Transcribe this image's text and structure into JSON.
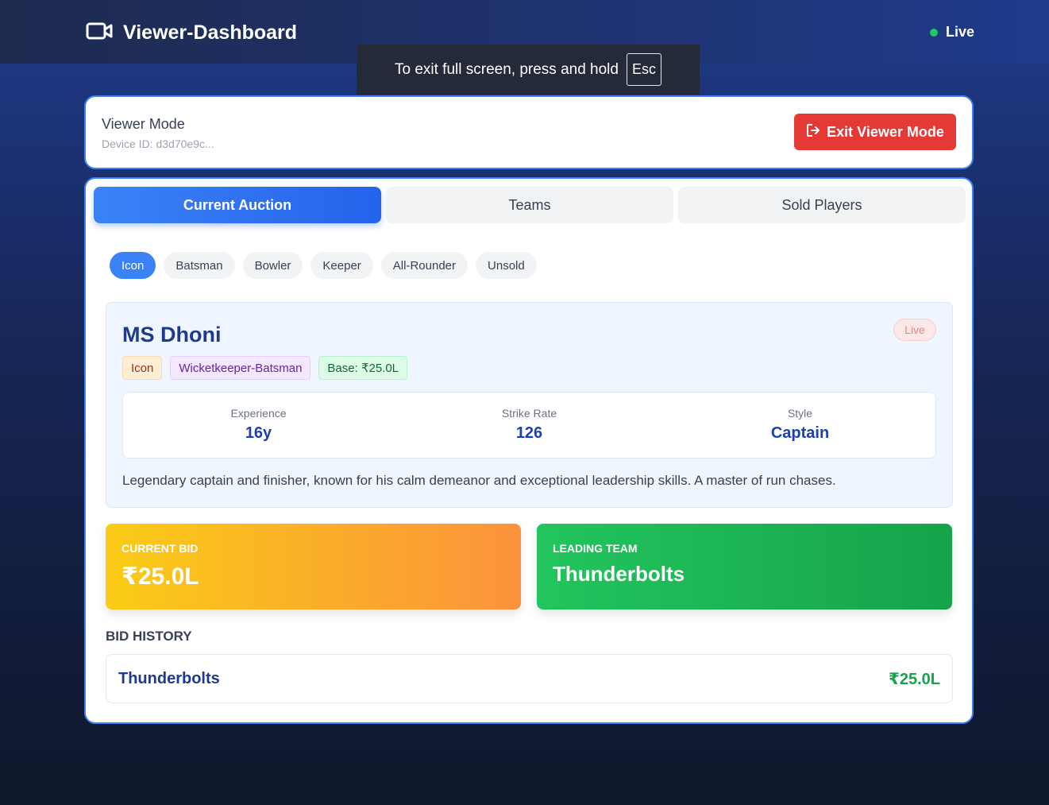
{
  "header": {
    "title": "Viewer-Dashboard",
    "icon": "video-camera-icon",
    "status_label": "Live",
    "status_color": "#22c55e"
  },
  "fullscreen_notice": {
    "text": "To exit full screen, press and hold",
    "key": "Esc"
  },
  "viewer": {
    "mode_label": "Viewer Mode",
    "device_id": "Device ID: d3d70e9c...",
    "exit_label": "Exit Viewer Mode",
    "exit_icon": "logout-icon",
    "exit_color": "#e53935"
  },
  "tabs": [
    {
      "label": "Current Auction",
      "active": true
    },
    {
      "label": "Teams",
      "active": false
    },
    {
      "label": "Sold Players",
      "active": false
    }
  ],
  "filters": [
    {
      "label": "Icon",
      "active": true
    },
    {
      "label": "Batsman",
      "active": false
    },
    {
      "label": "Bowler",
      "active": false
    },
    {
      "label": "Keeper",
      "active": false
    },
    {
      "label": "All-Rounder",
      "active": false
    },
    {
      "label": "Unsold",
      "active": false
    }
  ],
  "player": {
    "name": "MS Dhoni",
    "status": "Live",
    "tags": {
      "category": "Icon",
      "role": "Wicketkeeper-Batsman",
      "base": "Base: ₹25.0L"
    },
    "stats": [
      {
        "label": "Experience",
        "value": "16y"
      },
      {
        "label": "Strike Rate",
        "value": "126"
      },
      {
        "label": "Style",
        "value": "Captain"
      }
    ],
    "description": "Legendary captain and finisher, known for his calm demeanor and exceptional leadership skills. A master of run chases."
  },
  "current_bid": {
    "label": "CURRENT BID",
    "value": "₹25.0L"
  },
  "leading_team": {
    "label": "LEADING TEAM",
    "value": "Thunderbolts"
  },
  "bid_history": {
    "title": "BID HISTORY",
    "entries": [
      {
        "team": "Thunderbolts",
        "amount": "₹25.0L"
      }
    ]
  }
}
